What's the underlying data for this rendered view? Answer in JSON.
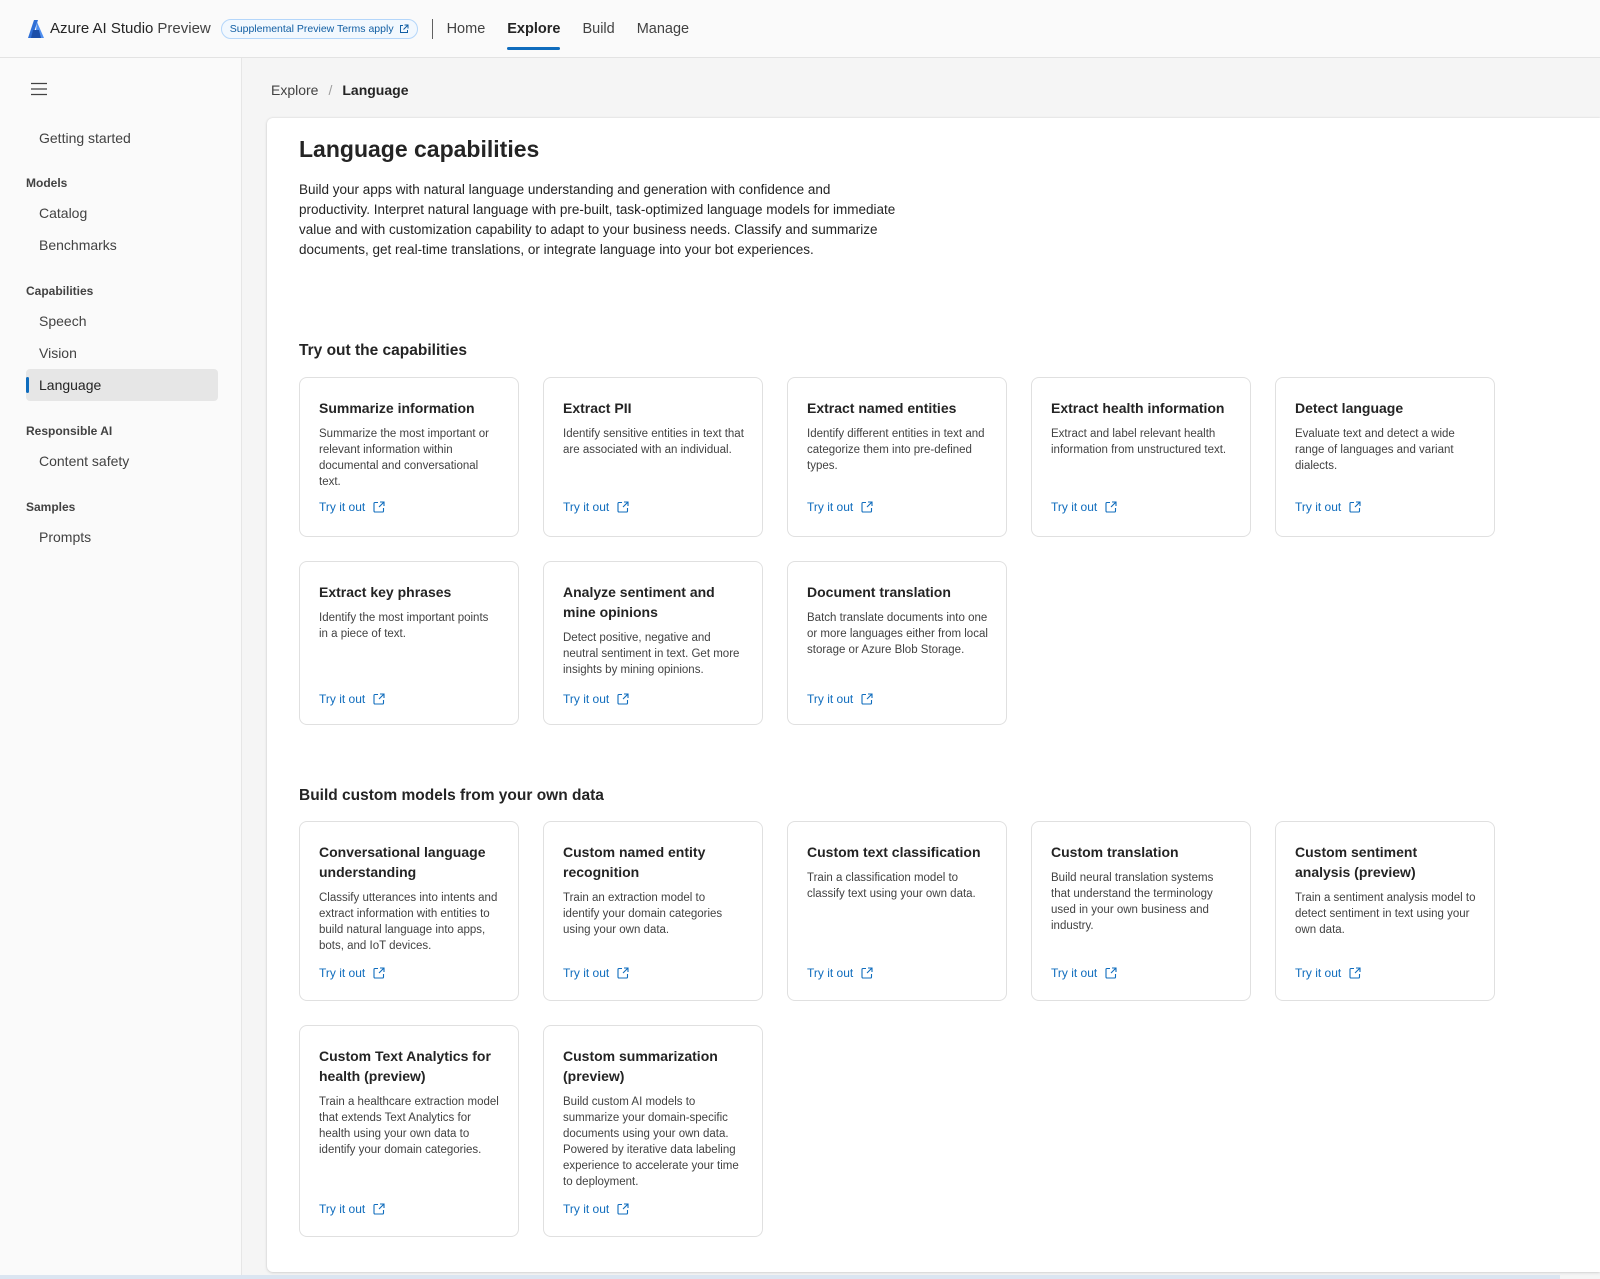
{
  "header": {
    "app_name": "Azure AI Studio",
    "app_suffix": "Preview",
    "terms_badge": "Supplemental Preview Terms apply",
    "nav": [
      "Home",
      "Explore",
      "Build",
      "Manage"
    ],
    "active_nav": "Explore"
  },
  "sidebar": {
    "getting_started": "Getting started",
    "sections": {
      "models": "Models",
      "capabilities": "Capabilities",
      "responsible_ai": "Responsible AI",
      "samples": "Samples"
    },
    "items": {
      "catalog": "Catalog",
      "benchmarks": "Benchmarks",
      "speech": "Speech",
      "vision": "Vision",
      "language": "Language",
      "content_safety": "Content safety",
      "prompts": "Prompts"
    },
    "active_item": "Language"
  },
  "breadcrumb": {
    "parent": "Explore",
    "current": "Language"
  },
  "main": {
    "title": "Language capabilities",
    "description": "Build your apps with natural language understanding and generation with confidence and productivity. Interpret natural language with pre-built, task-optimized language models for immediate value and with customization capability to adapt to your business needs. Classify and summarize documents, get real-time translations, or integrate language into your bot experiences.",
    "try_section_title": "Try out the capabilities",
    "custom_section_title": "Build custom models from your own data",
    "try_label": "Try it out",
    "try_cards": [
      {
        "title": "Summarize information",
        "desc": "Summarize the most important or relevant information within documental and conversational text."
      },
      {
        "title": "Extract PII",
        "desc": "Identify sensitive entities in text that are associated with an individual."
      },
      {
        "title": "Extract named entities",
        "desc": "Identify different entities in text and categorize them into pre-defined types."
      },
      {
        "title": "Extract health information",
        "desc": "Extract and label relevant health information from unstructured text."
      },
      {
        "title": "Detect language",
        "desc": "Evaluate text and detect a wide range of languages and variant dialects."
      },
      {
        "title": "Extract key phrases",
        "desc": "Identify the most important points in a piece of text."
      },
      {
        "title": "Analyze sentiment and mine opinions",
        "desc": "Detect positive, negative and neutral sentiment in text. Get more insights by mining opinions."
      },
      {
        "title": "Document translation",
        "desc": "Batch translate documents into one or more languages either from local storage or Azure Blob Storage."
      }
    ],
    "custom_cards": [
      {
        "title": "Conversational language understanding",
        "desc": "Classify utterances into intents and extract information with entities to build natural language into apps, bots, and IoT devices."
      },
      {
        "title": "Custom named entity recognition",
        "desc": "Train an extraction model to identify your domain categories using your own data."
      },
      {
        "title": "Custom text classification",
        "desc": "Train a classification model to classify text using your own data."
      },
      {
        "title": "Custom translation",
        "desc": "Build neural translation systems that understand the terminology used in your own business and industry."
      },
      {
        "title": "Custom sentiment analysis (preview)",
        "desc": "Train a sentiment analysis model to detect sentiment in text using your own data."
      },
      {
        "title": "Custom Text Analytics for health (preview)",
        "desc": "Train a healthcare extraction model that extends Text Analytics for health using your own data to identify your domain categories."
      },
      {
        "title": "Custom summarization (preview)",
        "desc": "Build custom AI models to summarize your domain-specific documents using your own data. Powered by iterative data labeling experience to accelerate your time to deployment."
      }
    ]
  },
  "colors": {
    "accent": "#0f6cbd",
    "card_border": "#e0e0e0",
    "selected_bg": "#e6e6e6"
  }
}
